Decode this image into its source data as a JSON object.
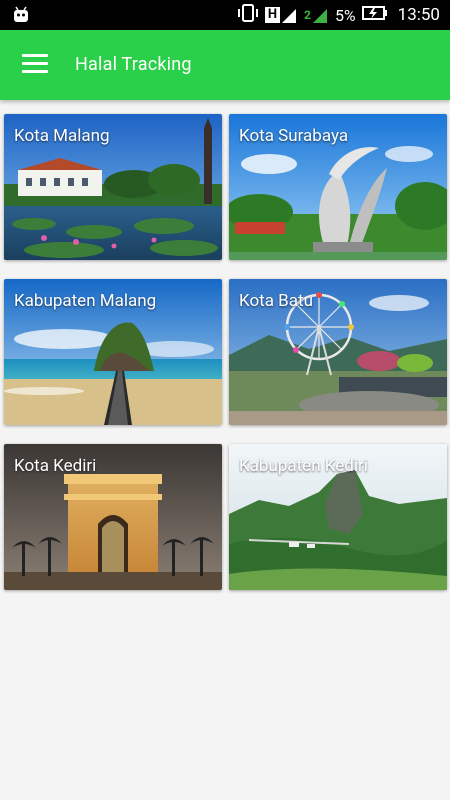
{
  "status_bar": {
    "battery_percent": "5%",
    "time": "13:50",
    "network_badge_1": "H",
    "network_badge_2": "2"
  },
  "app_bar": {
    "title": "Halal Tracking"
  },
  "cities": [
    {
      "label": "Kota Malang"
    },
    {
      "label": "Kota Surabaya"
    },
    {
      "label": "Kabupaten Malang"
    },
    {
      "label": "Kota Batu"
    },
    {
      "label": "Kota Kediri"
    },
    {
      "label": "Kabupaten Kediri"
    }
  ],
  "colors": {
    "app_bar": "#2bd04a",
    "status_bar": "#000000",
    "background": "#f4f4f4"
  }
}
